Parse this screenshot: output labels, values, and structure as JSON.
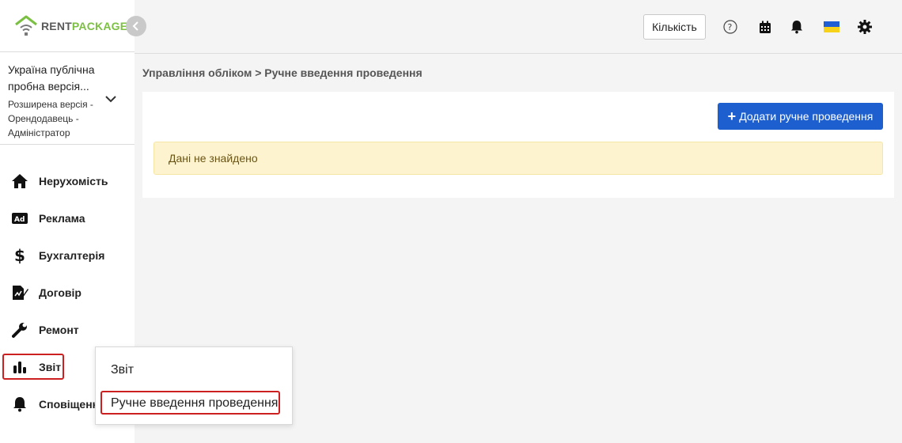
{
  "app": {
    "logo_rent": "RENT",
    "logo_package": "PACKAGE",
    "brand_colors": {
      "green": "#7cc043",
      "grey": "#5a5a5a",
      "primary": "#1d5fcf",
      "highlight": "#cc1f1f"
    }
  },
  "account": {
    "name_line1": "Україна публічна",
    "name_line2": "пробна версія...",
    "sub_line1": "Розширена версія -",
    "sub_line2": "Орендодавець -",
    "sub_line3": "Адміністратор",
    "expand_icon": "chevron-down-icon"
  },
  "sidebar": {
    "items": [
      {
        "label": "Нерухомість",
        "icon": "home-icon"
      },
      {
        "label": "Реклама",
        "icon": "ad-icon"
      },
      {
        "label": "Бухгалтерія",
        "icon": "dollar-icon"
      },
      {
        "label": "Договір",
        "icon": "contract-icon"
      },
      {
        "label": "Ремонт",
        "icon": "wrench-icon"
      },
      {
        "label": "Звіт",
        "icon": "bar-chart-icon"
      },
      {
        "label": "Сповіщенн",
        "icon": "bell-icon"
      }
    ]
  },
  "topbar": {
    "quantity_label": "Кількість",
    "icons": [
      "help-icon",
      "calendar-icon",
      "bell-icon",
      "ukraine-flag-icon",
      "gear-icon"
    ]
  },
  "breadcrumb": {
    "text": "Управління обліком > Ручне введення проведення"
  },
  "main": {
    "add_button_label": "Додати ручне проведення",
    "alert_text": "Дані не знайдено"
  },
  "submenu": {
    "items": [
      {
        "label": "Звіт"
      },
      {
        "label": "Ручне введення проведення"
      }
    ]
  }
}
